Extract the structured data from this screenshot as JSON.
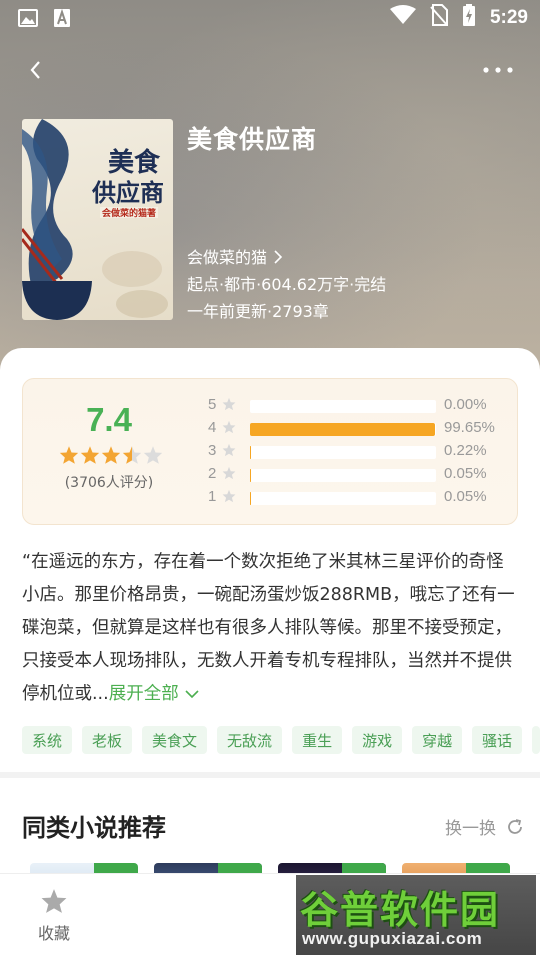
{
  "status_bar": {
    "time": "5:29"
  },
  "book": {
    "title": "美食供应商",
    "author": "会做菜的猫",
    "meta": "起点·都市·604.62万字·完结",
    "update": "一年前更新·2793章",
    "cover": {
      "title_chars": "美食供应商",
      "subtitle": "会做菜的猫著"
    }
  },
  "rating": {
    "score": "7.4",
    "stars": 3.5,
    "count_text": "(3706人评分)",
    "bars": [
      {
        "level": "5",
        "fraction": 0.0,
        "pct": "0.00%"
      },
      {
        "level": "4",
        "fraction": 0.9965,
        "pct": "99.65%"
      },
      {
        "level": "3",
        "fraction": 0.0022,
        "pct": "0.22%"
      },
      {
        "level": "2",
        "fraction": 0.0005,
        "pct": "0.05%"
      },
      {
        "level": "1",
        "fraction": 0.0005,
        "pct": "0.05%"
      }
    ]
  },
  "description": {
    "text": "“在遥远的东方，存在着一个数次拒绝了米其林三星评价的奇怪小店。那里价格昂贵，一碗配汤蛋炒饭288RMB，哦忘了还有一碟泡菜，但就算是这样也有很多人排队等候。那里不接受预定，只接受本人现场排队，无数人开着专机专程排队，当然并不提供停机位或...",
    "expand_label": "展开全部"
  },
  "tags": [
    "系统",
    "老板",
    "美食文",
    "无敌流",
    "重生",
    "游戏",
    "穿越",
    "骚话"
  ],
  "recommend": {
    "title": "同类小说推荐",
    "refresh_label": "换一换"
  },
  "bottom_bar": {
    "favorite_label": "收藏"
  },
  "watermark": {
    "name": "谷普软件园",
    "url": "www.gupuxiazai.com"
  },
  "colors": {
    "accent_green": "#4caf50",
    "score_green": "#49b155",
    "bar_orange": "#f6a623",
    "star_orange": "#f3a533"
  }
}
